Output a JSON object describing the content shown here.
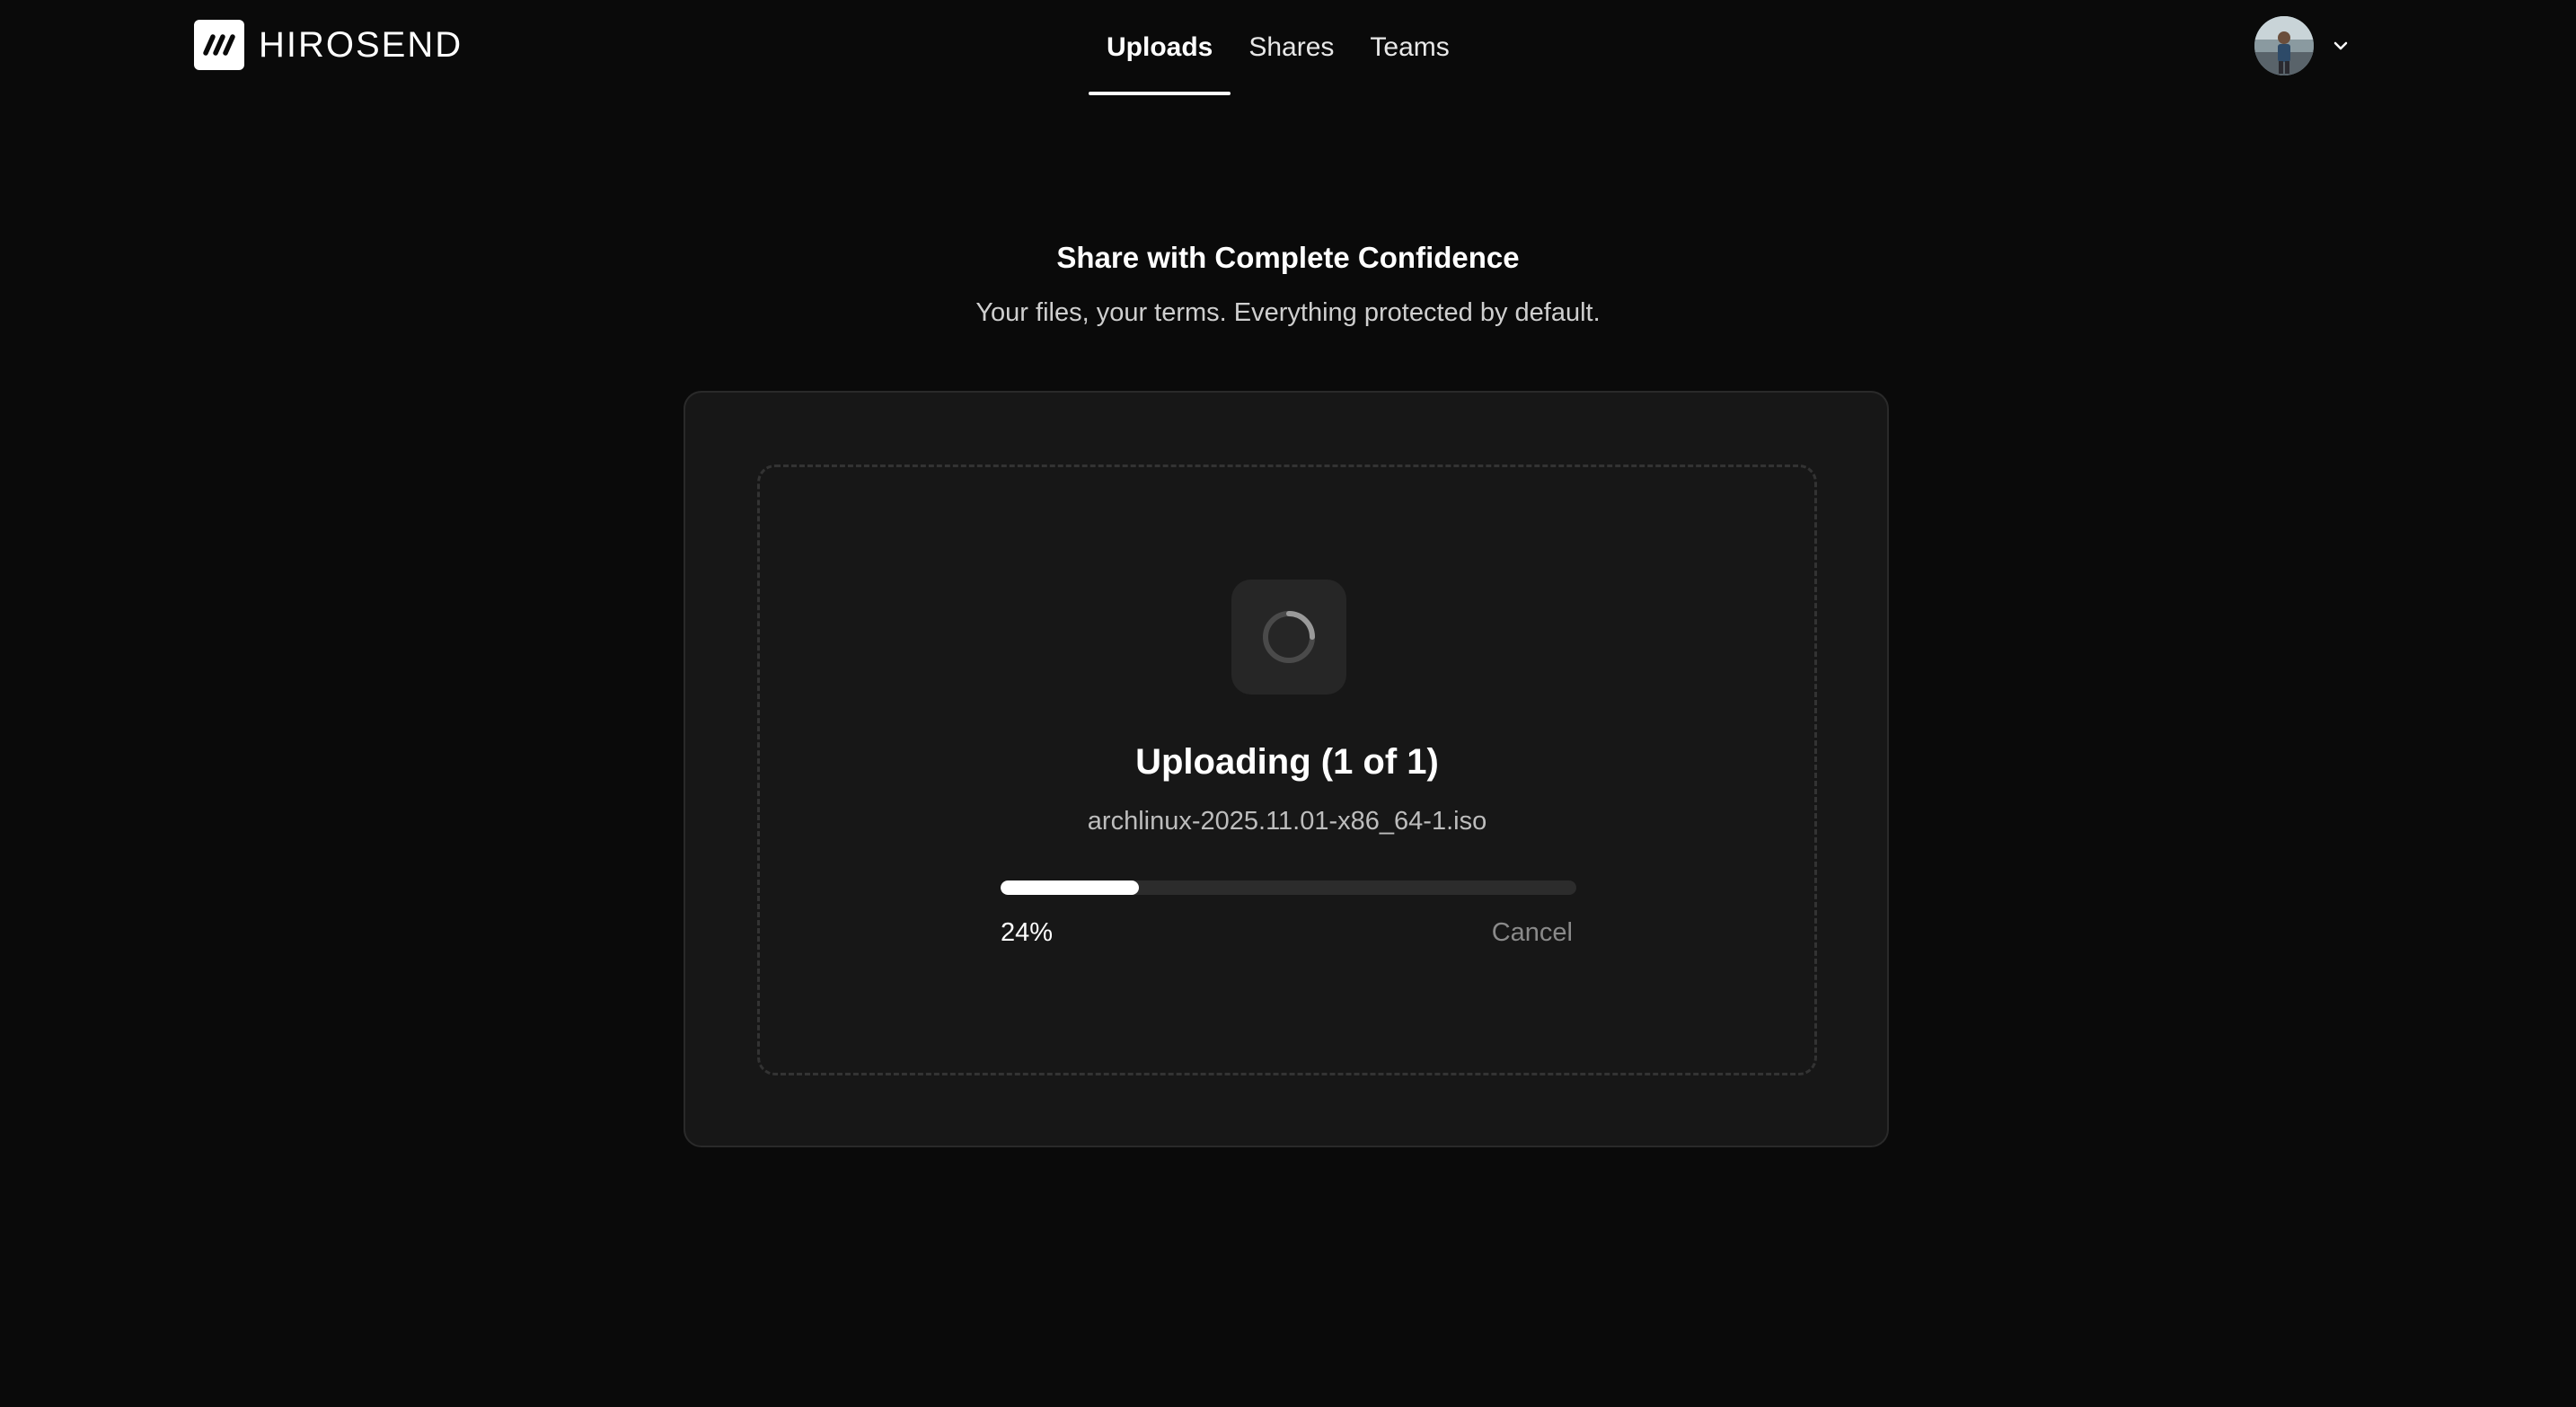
{
  "brand": {
    "name": "HIROSEND",
    "logo_icon": "slashes-logo-icon"
  },
  "nav": {
    "items": [
      {
        "label": "Uploads",
        "active": true
      },
      {
        "label": "Shares",
        "active": false
      },
      {
        "label": "Teams",
        "active": false
      }
    ]
  },
  "account": {
    "avatar_icon": "user-avatar",
    "menu_icon": "chevron-down-icon"
  },
  "hero": {
    "title": "Share with Complete Confidence",
    "subtitle": "Your files, your terms. Everything protected by default."
  },
  "upload": {
    "status_icon": "loading-spinner-icon",
    "title": "Uploading (1 of 1)",
    "file_name": "archlinux-2025.11.01-x86_64-1.iso",
    "progress_fraction": 0.24,
    "progress_label": "24%",
    "cancel_label": "Cancel"
  },
  "colors": {
    "background": "#0a0a0a",
    "card": "#171717",
    "accent": "#ffffff",
    "muted": "#8a8a8a"
  }
}
